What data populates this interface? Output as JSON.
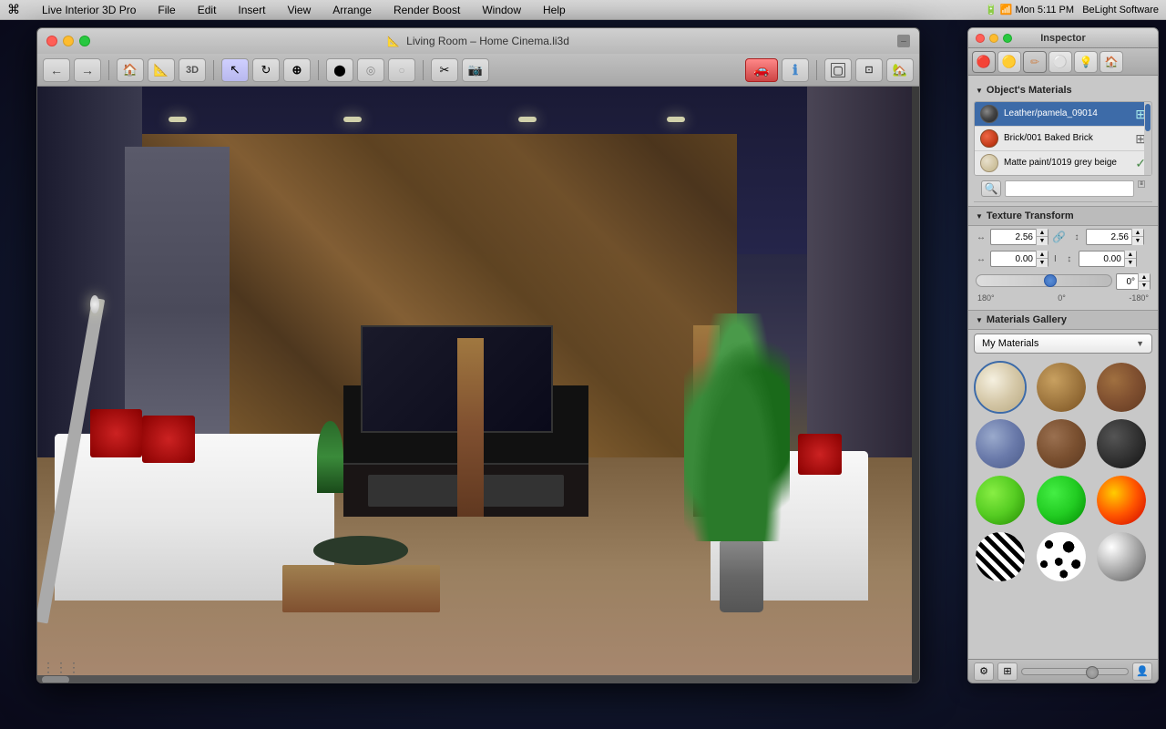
{
  "menubar": {
    "apple": "⌘",
    "items": [
      "Live Interior 3D Pro",
      "File",
      "Edit",
      "Insert",
      "View",
      "Arrange",
      "Render Boost",
      "Window",
      "Help"
    ],
    "right": "Mon 5:11 PM    BeLight Software"
  },
  "window": {
    "title": "Living Room – Home Cinema.li3d",
    "title_icon": "📐"
  },
  "toolbar": {
    "buttons": [
      "nav_back",
      "nav_fwd",
      "floor_plan",
      "elevation",
      "model",
      "select",
      "orbit",
      "pan",
      "sphere",
      "sphere2",
      "sphere3",
      "path",
      "camera",
      "nav_3d_back",
      "info",
      "frame_sel",
      "frame_all",
      "home"
    ]
  },
  "inspector": {
    "title": "Inspector",
    "tabs": [
      "materials_tab",
      "sphere_tab",
      "paint_tab",
      "metal_tab",
      "lamp_tab",
      "house_tab"
    ],
    "objects_materials_label": "Object's Materials",
    "materials": [
      {
        "name": "Leather/pamela_09014",
        "swatch_color": "#555555",
        "selected": true
      },
      {
        "name": "Brick/001 Baked Brick",
        "swatch_color": "#cc4422",
        "selected": false
      },
      {
        "name": "Matte paint/1019 grey beige",
        "swatch_color": "#d4c8b0",
        "selected": false
      }
    ],
    "texture_transform_label": "Texture Transform",
    "scale_x": "2.56",
    "scale_y": "2.56",
    "offset_x": "0.00",
    "offset_y": "0.00",
    "angle_value": "0°",
    "angle_min": "180°",
    "angle_zero": "0°",
    "angle_max": "-180°",
    "gallery_label": "Materials Gallery",
    "gallery_dropdown": "My Materials",
    "gallery_items": [
      {
        "name": "cream-sphere",
        "class": "swatch-cream",
        "selected": true
      },
      {
        "name": "wood-sphere-1",
        "class": "swatch-wood1",
        "selected": false
      },
      {
        "name": "wood-sphere-2",
        "class": "swatch-wood2",
        "selected": false
      },
      {
        "name": "metal-sphere",
        "class": "swatch-metal1",
        "selected": false
      },
      {
        "name": "brown-sphere",
        "class": "swatch-brown-sphere",
        "selected": false
      },
      {
        "name": "dark-sphere",
        "class": "swatch-dark",
        "selected": false
      },
      {
        "name": "green1-sphere",
        "class": "swatch-green1",
        "selected": false
      },
      {
        "name": "green2-sphere",
        "class": "swatch-green2",
        "selected": false
      },
      {
        "name": "fire-sphere",
        "class": "swatch-fire",
        "selected": false
      },
      {
        "name": "zebra-sphere",
        "class": "swatch-zebra",
        "selected": false
      },
      {
        "name": "spots-sphere",
        "class": "swatch-spots",
        "selected": false
      },
      {
        "name": "chrome-sphere",
        "class": "swatch-chrome",
        "selected": false
      }
    ]
  }
}
